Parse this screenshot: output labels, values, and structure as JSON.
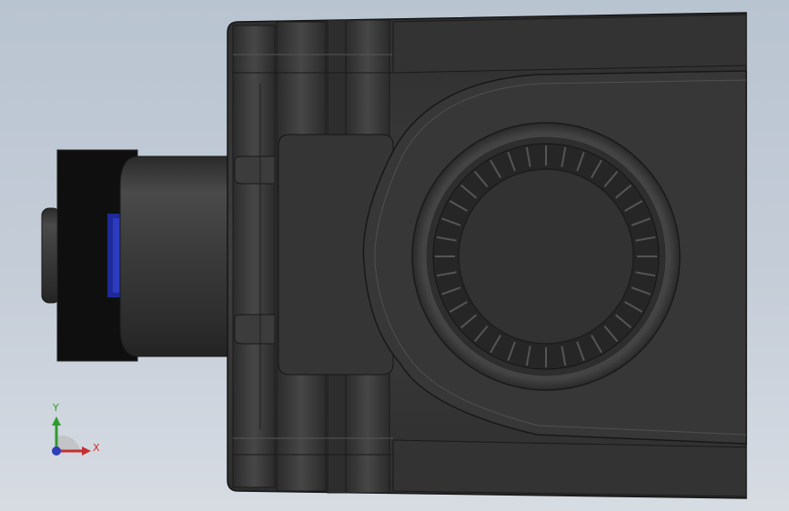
{
  "triad": {
    "axis_x_label": "X",
    "axis_y_label": "Y",
    "x_color": "#c43030",
    "y_color": "#2e9b2e",
    "z_color": "#2f3fb8"
  },
  "colors": {
    "background_top": "#b9c4d1",
    "background_bottom": "#d7dce3",
    "body": "#3a3a3a",
    "edge": "#1a1a1a",
    "highlight": "#5a5a5a",
    "connector_accent": "#2233aa"
  },
  "icons": [
    "coordinate-triad-icon"
  ]
}
